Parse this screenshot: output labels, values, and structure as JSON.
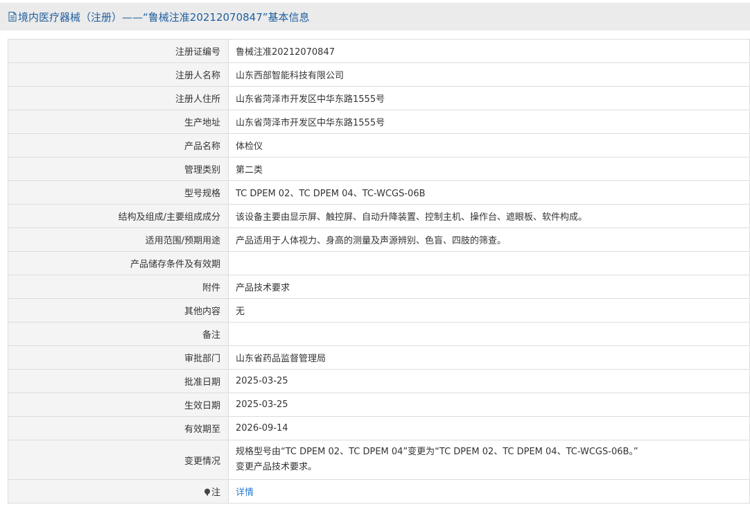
{
  "header": {
    "title": "境内医疗器械（注册）——“鲁械注准20212070847”基本信息"
  },
  "rows": [
    {
      "label": "注册证编号",
      "value": "鲁械注准20212070847"
    },
    {
      "label": "注册人名称",
      "value": "山东西部智能科技有限公司"
    },
    {
      "label": "注册人住所",
      "value": "山东省菏泽市开发区中华东路1555号"
    },
    {
      "label": "生产地址",
      "value": "山东省菏泽市开发区中华东路1555号"
    },
    {
      "label": "产品名称",
      "value": "体检仪"
    },
    {
      "label": "管理类别",
      "value": "第二类"
    },
    {
      "label": "型号规格",
      "value": "TC DPEM 02、TC DPEM 04、TC-WCGS-06B"
    },
    {
      "label": "结构及组成/主要组成成分",
      "value": "该设备主要由显示屏、触控屏、自动升降装置、控制主机、操作台、遮眼板、软件构成。"
    },
    {
      "label": "适用范围/预期用途",
      "value": "产品适用于人体视力、身高的测量及声源辨别、色盲、四肢的筛查。"
    },
    {
      "label": "产品储存条件及有效期",
      "value": ""
    },
    {
      "label": "附件",
      "value": "产品技术要求"
    },
    {
      "label": "其他内容",
      "value": "无"
    },
    {
      "label": "备注",
      "value": ""
    },
    {
      "label": "审批部门",
      "value": "山东省药品监督管理局"
    },
    {
      "label": "批准日期",
      "value": "2025-03-25"
    },
    {
      "label": "生效日期",
      "value": "2025-03-25"
    },
    {
      "label": "有效期至",
      "value": "2026-09-14"
    }
  ],
  "change": {
    "label": "变更情况",
    "line1": "规格型号由“TC DPEM 02、TC DPEM 04”变更为“TC DPEM 02、TC DPEM 04、TC-WCGS-06B。”",
    "line2": "变更产品技术要求。"
  },
  "note": {
    "label": "注",
    "link_text": "详情"
  }
}
